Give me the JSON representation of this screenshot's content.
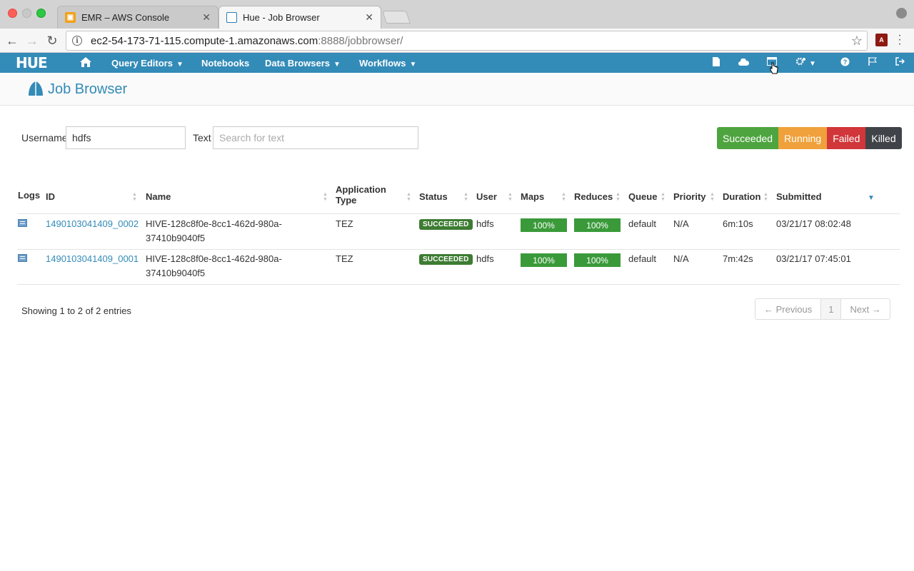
{
  "browser": {
    "tabs": [
      {
        "title": "EMR – AWS Console",
        "active": false,
        "favicon": "aws-cube-icon"
      },
      {
        "title": "Hue - Job Browser",
        "active": true,
        "favicon": "hue-logo-icon"
      }
    ],
    "url_host": "ec2-54-173-71-115.compute-1.amazonaws.com",
    "url_path": ":8888/jobbrowser/"
  },
  "hue_nav": {
    "logo": "HUE",
    "menus": [
      "Query Editors",
      "Notebooks",
      "Data Browsers",
      "Workflows"
    ],
    "accent": "#338bb8"
  },
  "page": {
    "title": "Job Browser"
  },
  "filters": {
    "username_label": "Username",
    "username_value": "hdfs",
    "text_label": "Text",
    "text_placeholder": "Search for text",
    "status_buttons": [
      {
        "label": "Succeeded",
        "color": "#4ea43f"
      },
      {
        "label": "Running",
        "color": "#f0a13b"
      },
      {
        "label": "Failed",
        "color": "#d0363a"
      },
      {
        "label": "Killed",
        "color": "#404448"
      }
    ]
  },
  "table": {
    "headers": {
      "logs": "Logs",
      "id": "ID",
      "name": "Name",
      "app_type_1": "Application",
      "app_type_2": "Type",
      "status": "Status",
      "user": "User",
      "maps": "Maps",
      "reduces": "Reduces",
      "queue": "Queue",
      "priority": "Priority",
      "duration": "Duration",
      "submitted": "Submitted"
    },
    "rows": [
      {
        "id": "1490103041409_0002",
        "name_1": "HIVE-128c8f0e-8cc1-462d-980a-",
        "name_2": "37410b9040f5",
        "app_type": "TEZ",
        "status": "SUCCEEDED",
        "user": "hdfs",
        "maps": "100%",
        "reduces": "100%",
        "queue": "default",
        "priority": "N/A",
        "duration": "6m:10s",
        "submitted": "03/21/17 08:02:48"
      },
      {
        "id": "1490103041409_0001",
        "name_1": "HIVE-128c8f0e-8cc1-462d-980a-",
        "name_2": "37410b9040f5",
        "app_type": "TEZ",
        "status": "SUCCEEDED",
        "user": "hdfs",
        "maps": "100%",
        "reduces": "100%",
        "queue": "default",
        "priority": "N/A",
        "duration": "7m:42s",
        "submitted": "03/21/17 07:45:01"
      }
    ]
  },
  "footer": {
    "showing": "Showing 1 to 2 of 2 entries",
    "prev": "← Previous",
    "page": "1",
    "next": "Next →"
  }
}
